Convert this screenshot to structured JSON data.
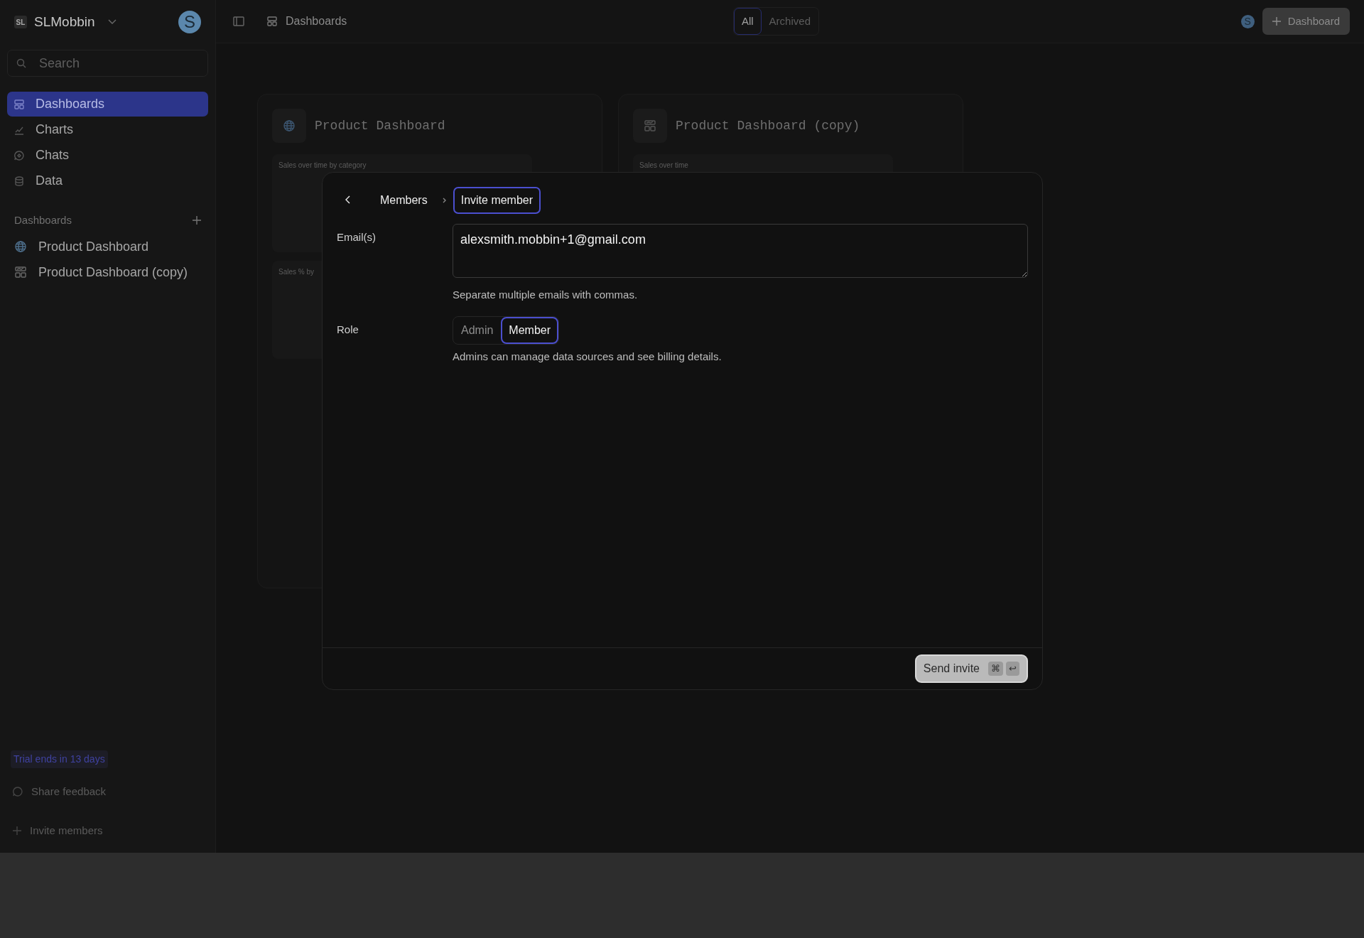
{
  "workspace": {
    "initials": "SL",
    "name": "SLMobbin",
    "avatar": "S"
  },
  "search": {
    "placeholder": "Search"
  },
  "nav": [
    {
      "label": "Dashboards",
      "selected": true
    },
    {
      "label": "Charts",
      "selected": false
    },
    {
      "label": "Chats",
      "selected": false
    },
    {
      "label": "Data",
      "selected": false
    }
  ],
  "dashboards_section": {
    "title": "Dashboards",
    "items": [
      {
        "label": "Product Dashboard"
      },
      {
        "label": "Product Dashboard (copy)"
      }
    ]
  },
  "trial": "Trial ends in 13 days",
  "footer_links": [
    "Share feedback",
    "Invite members"
  ],
  "topbar": {
    "breadcrumb": "Dashboards",
    "filters": [
      {
        "label": "All",
        "selected": true
      },
      {
        "label": "Archived",
        "selected": false
      }
    ],
    "avatar": "S",
    "new_button": "Dashboard"
  },
  "cards": [
    {
      "title": "Product Dashboard",
      "panels": [
        "Sales over time by category",
        "Sales % by"
      ]
    },
    {
      "title": "Product Dashboard (copy)",
      "panels": [
        "Sales over time"
      ]
    }
  ],
  "modal": {
    "breadcrumb": [
      {
        "label": "Members",
        "selected": false
      },
      {
        "label": "Invite member",
        "selected": true
      }
    ],
    "email": {
      "label": "Email(s)",
      "value": "alexsmith.mobbin+1@gmail.com",
      "help": "Separate multiple emails with commas."
    },
    "role": {
      "label": "Role",
      "options": [
        {
          "label": "Admin",
          "selected": false
        },
        {
          "label": "Member",
          "selected": true
        }
      ],
      "help": "Admins can manage data sources and see billing details."
    },
    "submit": {
      "label": "Send invite",
      "keys": [
        "⌘",
        "↩"
      ]
    }
  }
}
